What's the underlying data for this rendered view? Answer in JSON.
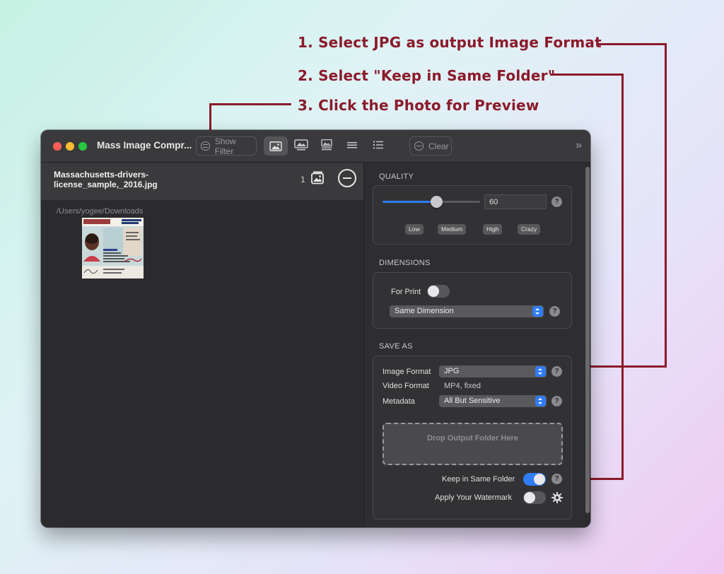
{
  "annotations": [
    "1. Select JPG as output Image Format",
    "2. Select \"Keep in Same Folder\"",
    "3. Click the Photo for Preview"
  ],
  "colors": {
    "annotation": "#8b1a2a",
    "accent": "#2f7cf6",
    "window_bg": "#2b2b2d"
  },
  "window": {
    "title": "Mass Image Compr...",
    "toolbar": {
      "show_filter": "Show Filter",
      "clear": "Clear",
      "view_icons": [
        "image-large-icon",
        "image-medium-icon",
        "image-small-icon",
        "list-icon",
        "detail-list-icon"
      ],
      "active_view": 0
    }
  },
  "file_list": {
    "selected_file_name_line1": "Massachusetts-drivers-",
    "selected_file_name_line2": "license_sample,_2016.jpg",
    "count": "1",
    "folder_path": "/Users/yogee/Downloads"
  },
  "settings": {
    "quality": {
      "label": "QUALITY",
      "value": "60",
      "slider_fraction": 0.55,
      "presets": [
        "Low",
        "Medium",
        "High",
        "Crazy"
      ]
    },
    "dimensions": {
      "label": "DIMENSIONS",
      "for_print_label": "For Print",
      "for_print_on": false,
      "dimension_option": "Same Dimension"
    },
    "save_as": {
      "label": "SAVE AS",
      "image_format_label": "Image Format",
      "image_format_value": "JPG",
      "video_format_label": "Video Format",
      "video_format_value": "MP4, fixed",
      "metadata_label": "Metadata",
      "metadata_value": "All But Sensitive",
      "drop_zone": "Drop Output Folder Here",
      "keep_same_folder_label": "Keep in Same Folder",
      "keep_same_folder_on": true,
      "watermark_label": "Apply Your Watermark",
      "watermark_on": false
    }
  }
}
